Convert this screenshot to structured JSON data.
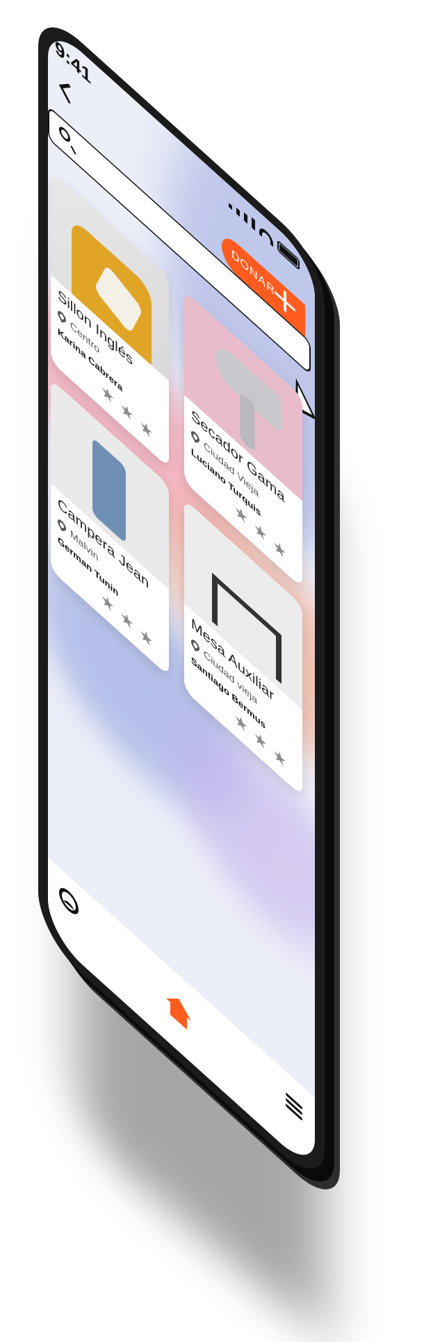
{
  "status_bar": {
    "time": "9:41"
  },
  "search": {
    "placeholder": ""
  },
  "donate_button": {
    "label": "DONAR"
  },
  "products": [
    {
      "title": "Sillon Inglés",
      "location": "Centro",
      "user": "Karina Cabrera",
      "stars": 3
    },
    {
      "title": "Secador Gama",
      "location": "Ciudad Vieja",
      "user": "Luciano Turquis",
      "stars": 3
    },
    {
      "title": "Campera Jean",
      "location": "Malvin",
      "user": "German Tunin",
      "stars": 3
    },
    {
      "title": "Mesa Auxiliar",
      "location": "Ciudad vieja",
      "user": "Santiago Bermus",
      "stars": 3
    }
  ],
  "colors": {
    "accent": "#ff5d1f",
    "card_bg": "#ffffff",
    "star": "#8c8c8c"
  },
  "icons": {
    "back": "chevron-left-icon",
    "search": "search-icon",
    "donate_plus": "plus-icon",
    "cursor": "cursor-icon",
    "location": "pin-icon",
    "star": "star-icon",
    "profile": "profile-icon",
    "home": "home-icon",
    "menu": "menu-icon"
  }
}
